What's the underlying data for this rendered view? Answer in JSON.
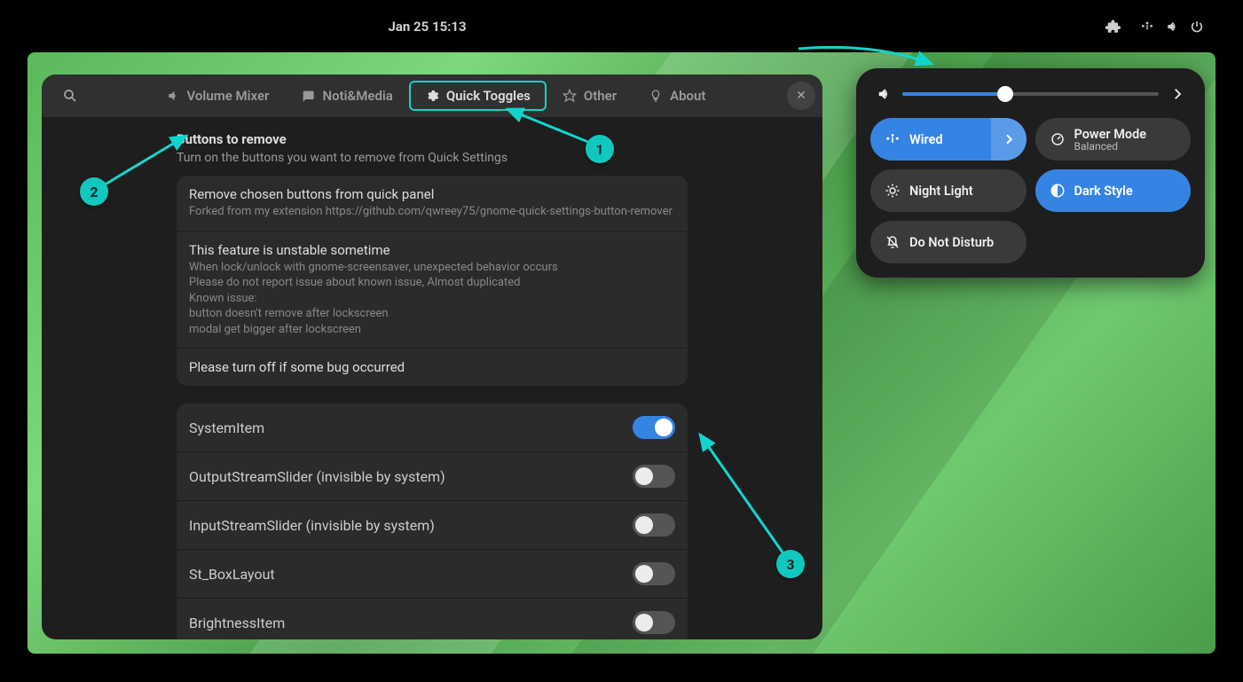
{
  "topbar": {
    "clock": "Jan 25  15:13"
  },
  "tabs": {
    "volume": "Volume Mixer",
    "noti": "Noti&Media",
    "quick": "Quick Toggles",
    "other": "Other",
    "about": "About"
  },
  "section": {
    "title": "Buttons to remove",
    "sub": "Turn on the buttons you want to remove from Quick Settings"
  },
  "info": {
    "r1t": "Remove chosen buttons from quick panel",
    "r1s": "Forked from my extension https://github.com/qwreey75/gnome-quick-settings-button-remover",
    "r2t": "This feature is unstable sometime",
    "r2s": "When lock/unlock with gnome-screensaver, unexpected behavior occurs\nPlease do not report issue about known issue, Almost duplicated\nKnown issue:\n  button doesn't remove after lockscreen\n  modal get bigger after lockscreen",
    "r3t": "Please turn off if some bug occurred"
  },
  "toggles": [
    {
      "label": "SystemItem",
      "on": true
    },
    {
      "label": "OutputStreamSlider (invisible by system)",
      "on": false
    },
    {
      "label": "InputStreamSlider (invisible by system)",
      "on": false
    },
    {
      "label": "St_BoxLayout",
      "on": false
    },
    {
      "label": "BrightnessItem",
      "on": false
    }
  ],
  "qs": {
    "volume_pct": 40,
    "wired": "Wired",
    "power_title": "Power Mode",
    "power_sub": "Balanced",
    "night": "Night Light",
    "dark": "Dark Style",
    "dnd": "Do Not Disturb"
  },
  "annotations": {
    "a1": "1",
    "a2": "2",
    "a3": "3"
  },
  "colors": {
    "accent": "#3584e4",
    "anno": "#10c8be",
    "highlight": "#17d1c7"
  }
}
